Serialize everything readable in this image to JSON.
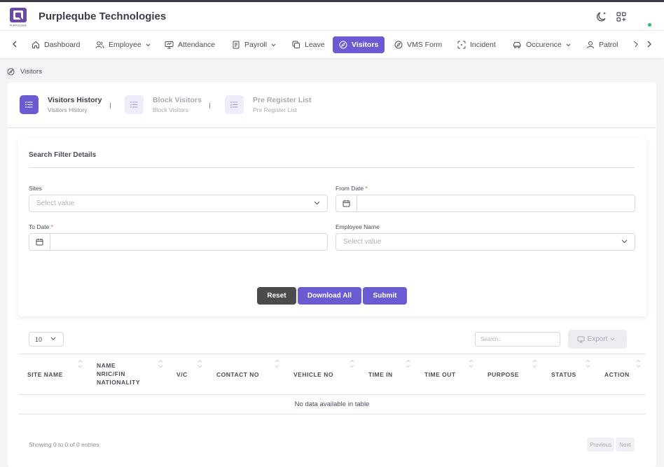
{
  "app": {
    "name": "Purpleqube Technologies",
    "logo_text": "PURPLEQUBE"
  },
  "colors": {
    "accent": "#6b5bd2",
    "reset": "#4b4b4b",
    "online": "#28c76f"
  },
  "nav": {
    "items": [
      {
        "label": "Dashboard",
        "icon": "home-icon"
      },
      {
        "label": "Employee",
        "icon": "users-icon",
        "dropdown": true
      },
      {
        "label": "Attendance",
        "icon": "monitor-icon"
      },
      {
        "label": "Payroll",
        "icon": "file-icon",
        "dropdown": true
      },
      {
        "label": "Leave",
        "icon": "copy-icon"
      },
      {
        "label": "Visitors",
        "icon": "compass-icon",
        "active": true
      },
      {
        "label": "VMS Form",
        "icon": "compass-icon"
      },
      {
        "label": "Incident",
        "icon": "scan-icon"
      },
      {
        "label": "Occurence",
        "icon": "car-icon",
        "dropdown": true
      },
      {
        "label": "Patrol",
        "icon": "user-icon"
      }
    ]
  },
  "breadcrumb": {
    "label": "Visitors"
  },
  "tabs": [
    {
      "title": "Visitors History",
      "subtitle": "Visitors History",
      "active": true
    },
    {
      "title": "Block Visitors",
      "subtitle": "Block Visitors"
    },
    {
      "title": "Pre Register List",
      "subtitle": "Pre Register List"
    }
  ],
  "filter": {
    "title": "Search Filter Details",
    "sites": {
      "label": "Sites",
      "placeholder": "Select value"
    },
    "from_date": {
      "label": "From Date",
      "required": "*",
      "value": ""
    },
    "to_date": {
      "label": "To Date",
      "required": "*",
      "value": ""
    },
    "employee": {
      "label": "Employee Name",
      "placeholder": "Select value"
    },
    "buttons": {
      "reset": "Reset",
      "download": "Download All",
      "submit": "Submit"
    }
  },
  "table": {
    "page_length": "10",
    "search_placeholder": "Search..",
    "export_label": "Export",
    "columns": [
      "SITE NAME",
      "NAME\nNRIC/FIN\nNATIONALITY",
      "V/C",
      "CONTACT NO",
      "VEHICLE NO",
      "TIME IN",
      "TIME OUT",
      "PURPOSE",
      "STATUS",
      "ACTION"
    ],
    "empty_message": "No data available in table",
    "info": "Showing 0 to 0 of 0 entries",
    "previous": "Previous",
    "next": "Next"
  }
}
